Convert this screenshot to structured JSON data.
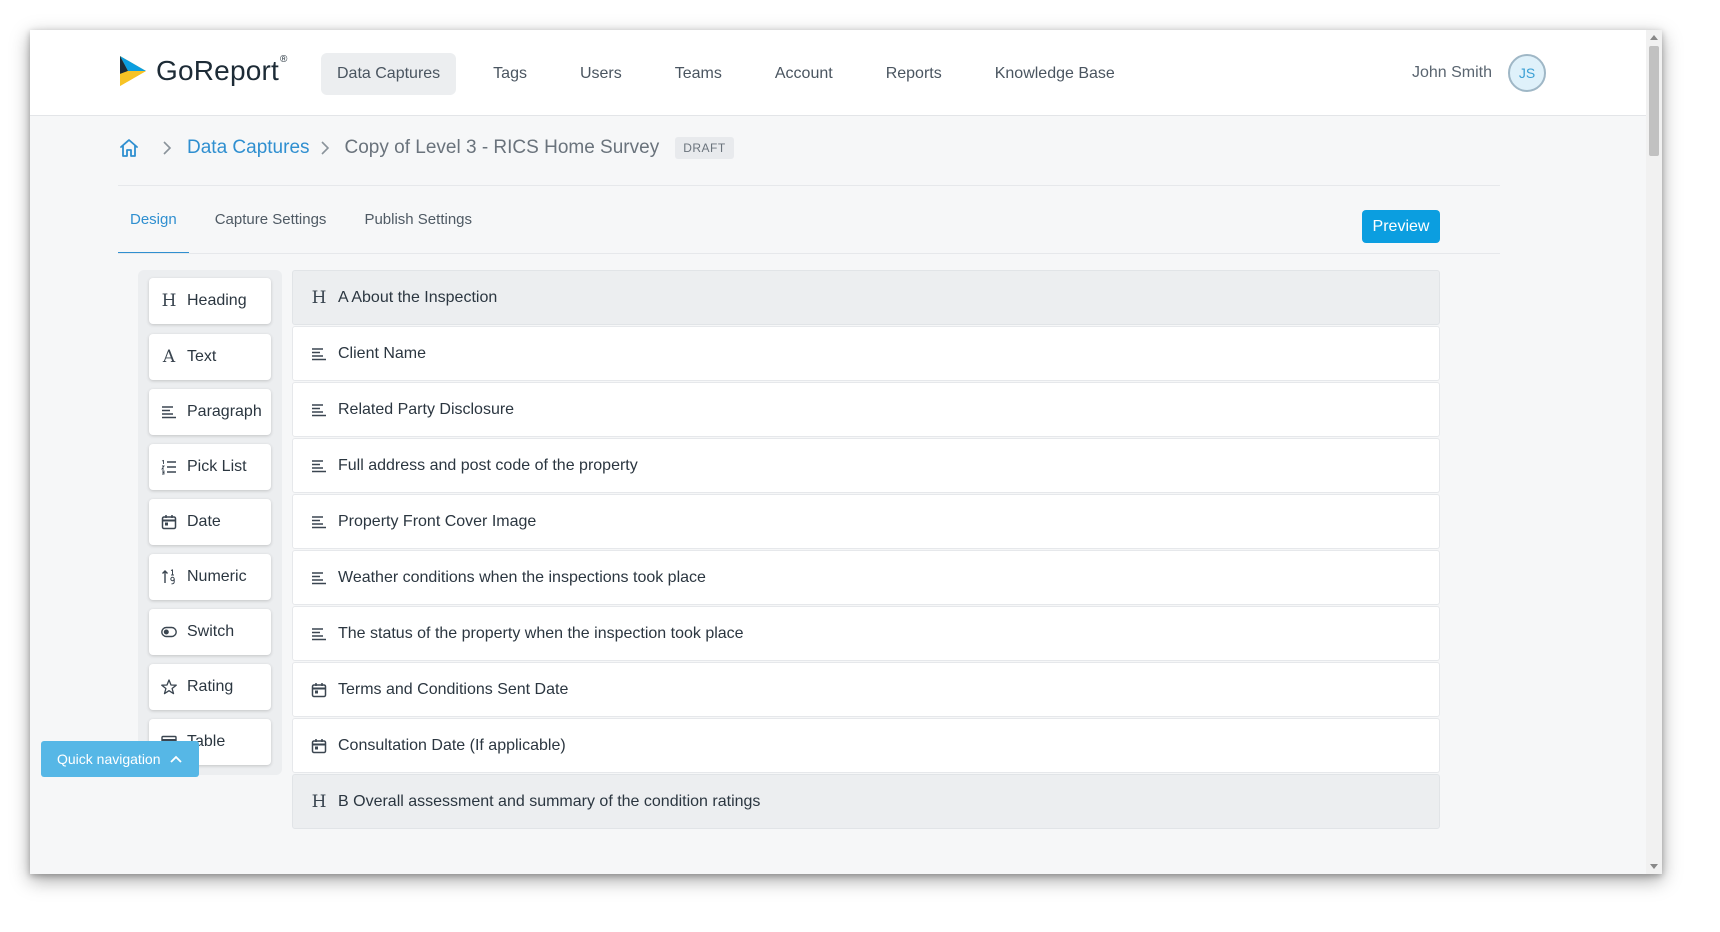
{
  "app": {
    "logo_text": "GoReport",
    "logo_reg": "®"
  },
  "nav": {
    "items": [
      {
        "label": "Data Captures",
        "active": true
      },
      {
        "label": "Tags"
      },
      {
        "label": "Users"
      },
      {
        "label": "Teams"
      },
      {
        "label": "Account"
      },
      {
        "label": "Reports"
      },
      {
        "label": "Knowledge Base"
      }
    ]
  },
  "user": {
    "name": "John Smith",
    "initials": "JS"
  },
  "breadcrumb": {
    "home_icon": "home-icon",
    "link": "Data Captures",
    "current": "Copy of Level 3 - RICS Home Survey",
    "badge": "DRAFT"
  },
  "tabs": [
    {
      "label": "Design",
      "active": true
    },
    {
      "label": "Capture Settings"
    },
    {
      "label": "Publish Settings"
    }
  ],
  "preview_label": "Preview",
  "palette": [
    {
      "label": "Heading",
      "icon": "H"
    },
    {
      "label": "Text",
      "icon": "A"
    },
    {
      "label": "Paragraph",
      "icon": "paragraph"
    },
    {
      "label": "Pick List",
      "icon": "list"
    },
    {
      "label": "Date",
      "icon": "calendar"
    },
    {
      "label": "Numeric",
      "icon": "numeric"
    },
    {
      "label": "Switch",
      "icon": "toggle"
    },
    {
      "label": "Rating",
      "icon": "star"
    },
    {
      "label": "Table",
      "icon": "table"
    }
  ],
  "fields": [
    {
      "label": "A About the Inspection",
      "type": "heading"
    },
    {
      "label": "Client Name",
      "type": "paragraph"
    },
    {
      "label": "Related Party Disclosure",
      "type": "paragraph"
    },
    {
      "label": "Full address and post code of the property",
      "type": "paragraph"
    },
    {
      "label": "Property Front Cover Image",
      "type": "paragraph"
    },
    {
      "label": "Weather conditions when the inspections took place",
      "type": "paragraph"
    },
    {
      "label": "The status of the property when the inspection took place",
      "type": "paragraph"
    },
    {
      "label": "Terms and Conditions Sent Date",
      "type": "date"
    },
    {
      "label": "Consultation Date (If applicable)",
      "type": "date"
    },
    {
      "label": "B Overall assessment and summary of the condition ratings",
      "type": "heading"
    }
  ],
  "quick_nav_label": "Quick navigation",
  "colors": {
    "accent": "#0b9ee0",
    "link": "#2f8fd0",
    "quick_nav": "#56b7e6"
  }
}
